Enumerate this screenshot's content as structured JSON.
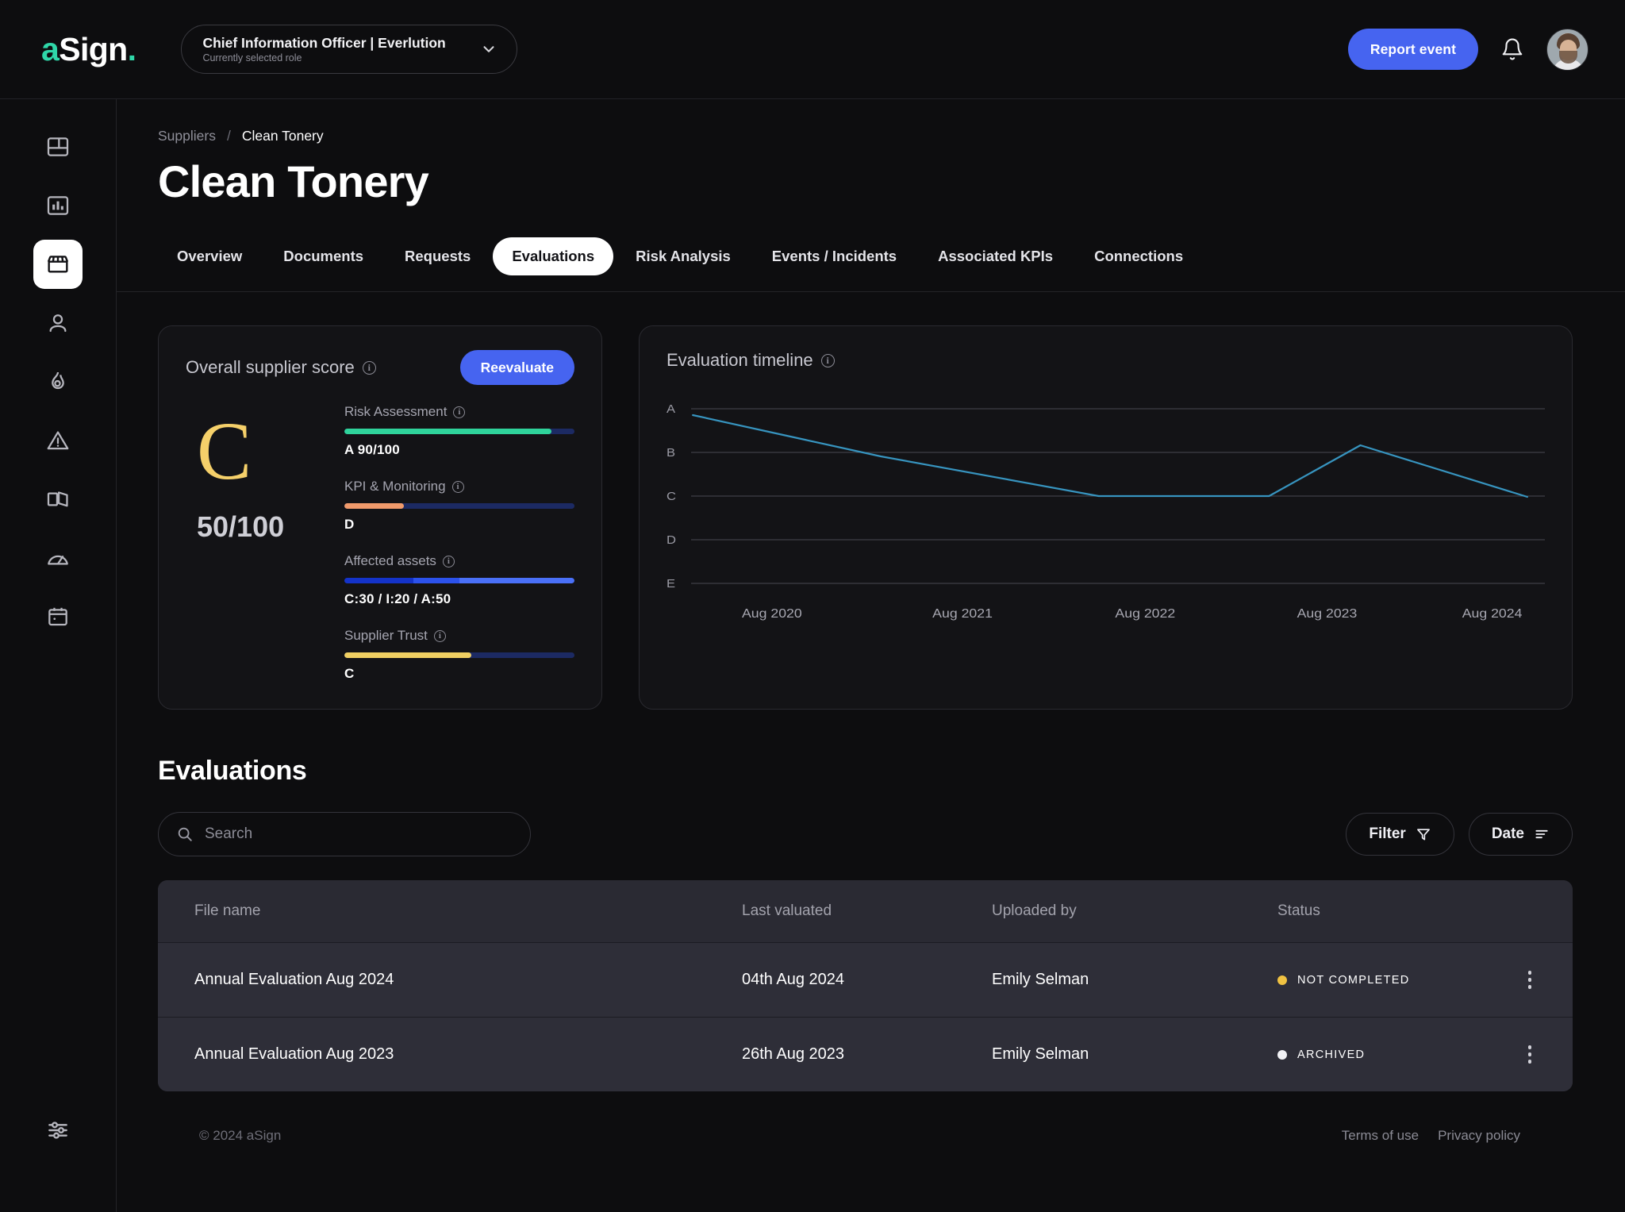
{
  "brand": {
    "a": "a",
    "sign": "Sign",
    "dot": "."
  },
  "header": {
    "role_title": "Chief Information Officer | Everlution",
    "role_subtitle": "Currently selected role",
    "report_button": "Report event",
    "icons": {
      "chevron": "chevron-down-icon",
      "bell": "bell-icon",
      "avatar": "user-avatar"
    }
  },
  "sidebar": {
    "items": [
      {
        "name": "dashboard",
        "label": "Dashboard",
        "active": false
      },
      {
        "name": "analytics",
        "label": "Analytics",
        "active": false
      },
      {
        "name": "suppliers",
        "label": "Suppliers",
        "active": true
      },
      {
        "name": "people",
        "label": "People",
        "active": false
      },
      {
        "name": "heat",
        "label": "Heat",
        "active": false
      },
      {
        "name": "risks",
        "label": "Risks",
        "active": false
      },
      {
        "name": "library",
        "label": "Library",
        "active": false
      },
      {
        "name": "performance",
        "label": "Performance",
        "active": false
      },
      {
        "name": "calendar",
        "label": "Calendar",
        "active": false
      }
    ],
    "bottom": {
      "name": "settings",
      "label": "Settings"
    }
  },
  "breadcrumb": {
    "parent": "Suppliers",
    "separator": "/",
    "current": "Clean Tonery"
  },
  "page": {
    "title": "Clean Tonery"
  },
  "tabs": [
    {
      "label": "Overview",
      "active": false
    },
    {
      "label": "Documents",
      "active": false
    },
    {
      "label": "Requests",
      "active": false
    },
    {
      "label": "Evaluations",
      "active": true
    },
    {
      "label": "Risk Analysis",
      "active": false
    },
    {
      "label": "Events / Incidents",
      "active": false
    },
    {
      "label": "Associated KPIs",
      "active": false
    },
    {
      "label": "Connections",
      "active": false
    }
  ],
  "score_card": {
    "title": "Overall supplier score",
    "action": "Reevaluate",
    "grade": "C",
    "grade_color": "#f5d06a",
    "score": "50/100",
    "metrics": [
      {
        "label": "Risk Assessment",
        "value": "A 90/100",
        "percent": 90,
        "color": "#2fd39b"
      },
      {
        "label": "KPI & Monitoring",
        "value": "D",
        "percent": 26,
        "color": "#f09a6b"
      },
      {
        "label": "Affected assets",
        "value": "C:30 / I:20 / A:50",
        "segments": [
          {
            "percent": 30,
            "color": "#1433c9"
          },
          {
            "percent": 20,
            "color": "#2c52ec"
          },
          {
            "percent": 50,
            "color": "#4a70f7"
          }
        ]
      },
      {
        "label": "Supplier Trust",
        "value": "C",
        "percent": 55,
        "color": "#f0cf62"
      }
    ]
  },
  "chart_data": {
    "type": "line",
    "title": "Evaluation timeline",
    "xlabel": "",
    "ylabel": "",
    "grid": true,
    "legend": "none",
    "line_color": "#3794bf",
    "y_categories": [
      "A",
      "B",
      "C",
      "D",
      "E"
    ],
    "x_tick_labels": [
      "Aug 2020",
      "Aug 2021",
      "Aug 2022",
      "Aug 2023",
      "Aug 2024"
    ],
    "points": [
      {
        "x": "Aug 2019",
        "grade": "A",
        "y": 0.94
      },
      {
        "x": "Aug 2020",
        "grade": "A-",
        "y": 0.72
      },
      {
        "x": "Aug 2021",
        "grade": "B",
        "y": 2.05
      },
      {
        "x": "Aug 2022",
        "grade": "C",
        "y": 3.0
      },
      {
        "x": "Feb 2023",
        "grade": "C",
        "y": 3.0
      },
      {
        "x": "Nov 2023",
        "grade": "B+",
        "y": 1.82
      },
      {
        "x": "Aug 2024",
        "grade": "C",
        "y": 3.0
      }
    ]
  },
  "evaluations": {
    "section_title": "Evaluations",
    "search_placeholder": "Search",
    "search_value": "",
    "filter_label": "Filter",
    "date_label": "Date",
    "columns": [
      "File name",
      "Last valuated",
      "Uploaded by",
      "Status"
    ],
    "rows": [
      {
        "file": "Annual Evaluation Aug 2024",
        "date": "04th Aug 2024",
        "user": "Emily Selman",
        "status": "NOT COMPLETED",
        "status_color": "#f0c242"
      },
      {
        "file": "Annual Evaluation Aug 2023",
        "date": "26th Aug 2023",
        "user": "Emily Selman",
        "status": "ARCHIVED",
        "status_color": "#f2f2f5"
      }
    ]
  },
  "footer": {
    "copyright": "© 2024 aSign",
    "terms": "Terms of use",
    "privacy": "Privacy policy"
  }
}
